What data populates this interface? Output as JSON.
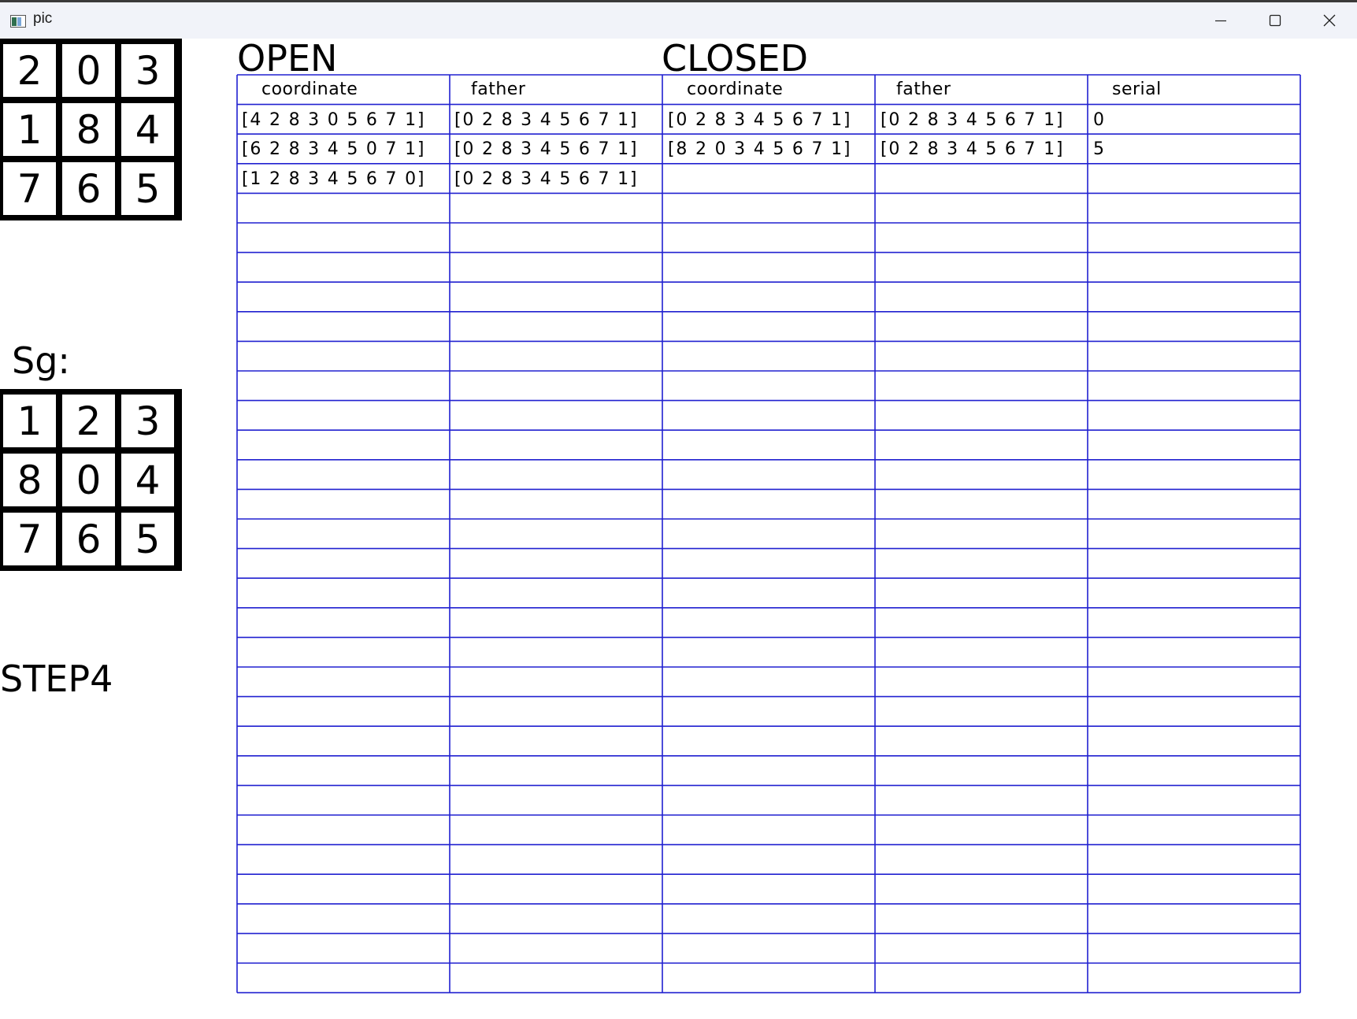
{
  "window": {
    "title": "pic"
  },
  "start_state": {
    "tiles": [
      "2",
      "0",
      "3",
      "1",
      "8",
      "4",
      "7",
      "6",
      "5"
    ]
  },
  "goal_label": "Sg:",
  "goal_state": {
    "tiles": [
      "1",
      "2",
      "3",
      "8",
      "0",
      "4",
      "7",
      "6",
      "5"
    ]
  },
  "step_label": "STEP4",
  "open": {
    "title": "OPEN",
    "headers": [
      "coordinate",
      "father"
    ],
    "rows": [
      [
        "[4 2 8 3 0 5 6 7 1]",
        "[0 2 8 3 4 5 6 7 1]"
      ],
      [
        "[6 2 8 3 4 5 0 7 1]",
        "[0 2 8 3 4 5 6 7 1]"
      ],
      [
        "[1 2 8 3 4 5 6 7 0]",
        "[0 2 8 3 4 5 6 7 1]"
      ]
    ]
  },
  "closed": {
    "title": "CLOSED",
    "headers": [
      "coordinate",
      "father",
      "serial"
    ],
    "rows": [
      [
        "[0 2 8 3 4 5 6 7 1]",
        "[0 2 8 3 4 5 6 7 1]",
        "0"
      ],
      [
        "[8 2 0 3 4 5 6 7 1]",
        "[0 2 8 3 4 5 6 7 1]",
        "5"
      ]
    ]
  },
  "table": {
    "line_color": "#2020d0",
    "row_count": 30
  },
  "icons": [
    "app-icon",
    "minimize-icon",
    "maximize-icon",
    "close-icon"
  ]
}
